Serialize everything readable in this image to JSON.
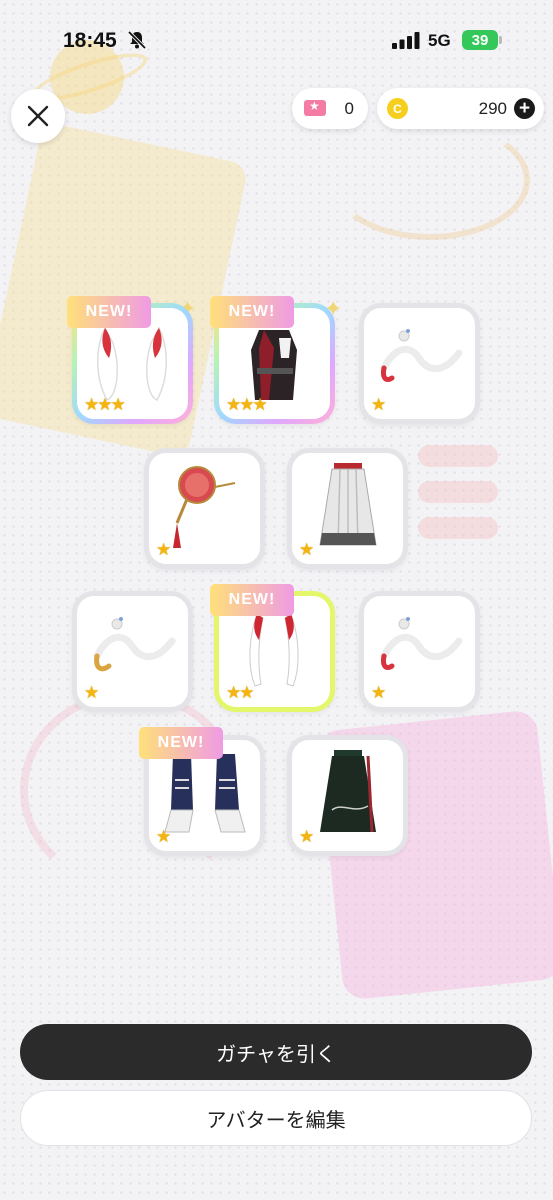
{
  "status_bar": {
    "time": "18:45",
    "network": "5G",
    "battery": "39"
  },
  "header": {
    "ticket_count": "0",
    "coin_count": "290"
  },
  "items": [
    {
      "name": "white-red-ears",
      "stars": "★★★",
      "new": true
    },
    {
      "name": "black-red-jacket",
      "stars": "★★★",
      "new": true
    },
    {
      "name": "white-dragon-accessory",
      "stars": "★",
      "new": false
    },
    {
      "name": "red-fan-accessory",
      "stars": "★",
      "new": false
    },
    {
      "name": "white-hakama-skirt",
      "stars": "★",
      "new": false
    },
    {
      "name": "gold-white-dragon-accessory",
      "stars": "★",
      "new": false
    },
    {
      "name": "red-white-horns",
      "stars": "★★",
      "new": true
    },
    {
      "name": "red-white-dragon-accessory",
      "stars": "★",
      "new": false
    },
    {
      "name": "navy-white-boots",
      "stars": "★",
      "new": true
    },
    {
      "name": "black-hakama-skirt",
      "stars": "★",
      "new": false
    }
  ],
  "new_badge_label": "NEW!",
  "buttons": {
    "gacha": "ガチャを引く",
    "edit_avatar": "アバターを編集"
  },
  "colors": {
    "primary_button": "#2b2b2b",
    "star": "#f5b50f",
    "battery": "#34c759",
    "coin": "#f6cf1e",
    "ticket": "#f47ba3"
  }
}
